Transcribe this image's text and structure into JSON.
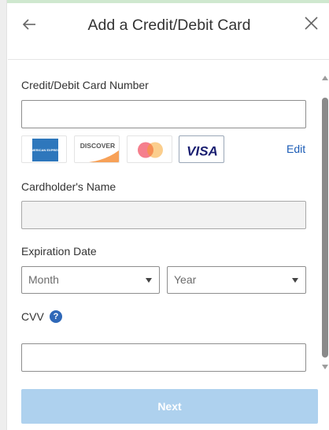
{
  "dialog": {
    "title": "Add a Credit/Debit Card"
  },
  "icons": {
    "back": "arrow-left-icon",
    "close": "close-icon",
    "help": "question-mark-icon"
  },
  "card_number": {
    "label": "Credit/Debit Card Number",
    "value": ""
  },
  "card_brands": {
    "amex_text": "AMERICAN EXPRESS",
    "discover_text": "DISCOVER",
    "visa_text": "VISA",
    "edit_label": "Edit"
  },
  "cardholder": {
    "label": "Cardholder's Name",
    "value": ""
  },
  "expiration": {
    "label": "Expiration Date",
    "month_selected": "Month",
    "year_selected": "Year"
  },
  "cvv": {
    "label": "CVV",
    "help_glyph": "?",
    "value": ""
  },
  "actions": {
    "next_label": "Next"
  },
  "colors": {
    "accent_link": "#1a5bb5",
    "next_button_disabled": "#aed1ee",
    "help_icon": "#2f68b8",
    "visa_blue": "#1a1f71",
    "discover_orange": "#f48120",
    "mastercard_red": "#eb001b",
    "mastercard_orange": "#f79e1b",
    "amex_blue": "#2e77bc"
  }
}
